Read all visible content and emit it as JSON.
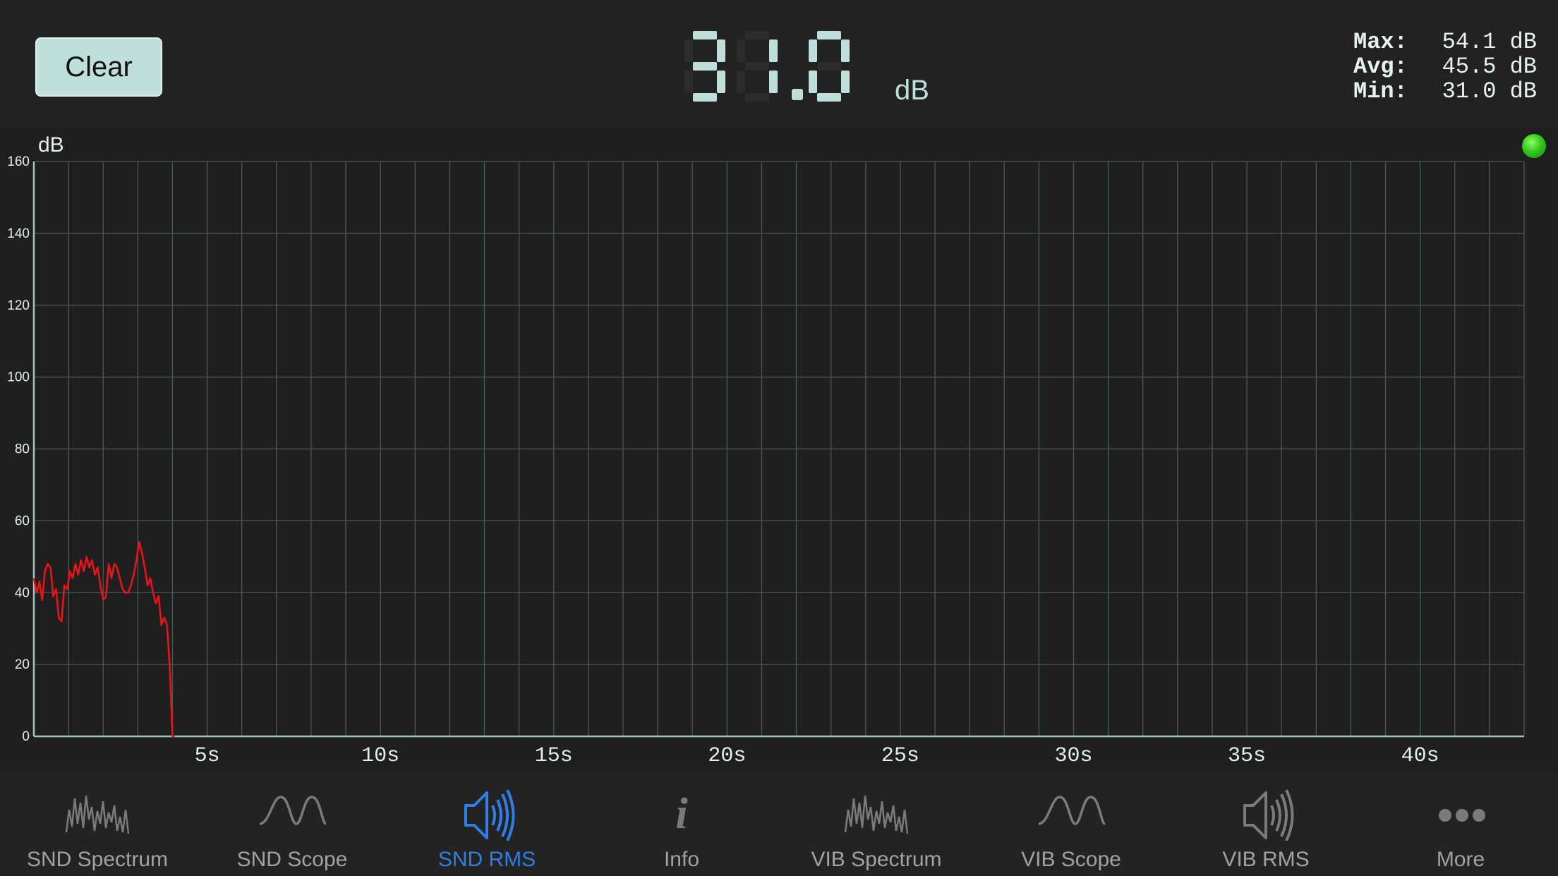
{
  "header": {
    "clear_label": "Clear",
    "reading_value": "31.0",
    "reading_unit": "dB",
    "stats": {
      "max_label": "Max:",
      "max_value": "54.1 dB",
      "avg_label": "Avg:",
      "avg_value": "45.5 dB",
      "min_label": "Min:",
      "min_value": "31.0 dB"
    }
  },
  "chart_data": {
    "type": "line",
    "ylabel": "dB",
    "xlabel": "",
    "ylim": [
      0,
      160
    ],
    "y_ticks": [
      "0",
      "20",
      "40",
      "60",
      "80",
      "100",
      "120",
      "140",
      "160"
    ],
    "x_ticks": [
      "5s",
      "10s",
      "15s",
      "20s",
      "25s",
      "30s",
      "35s",
      "40s"
    ],
    "x_tick_values": [
      5,
      10,
      15,
      20,
      25,
      30,
      35,
      40
    ],
    "xlim": [
      0,
      43
    ],
    "grid": true,
    "series": [
      {
        "color": "#e8141a",
        "x": [
          0.0,
          0.08,
          0.16,
          0.24,
          0.32,
          0.4,
          0.48,
          0.56,
          0.64,
          0.72,
          0.8,
          0.88,
          0.96,
          1.04,
          1.12,
          1.2,
          1.28,
          1.36,
          1.44,
          1.52,
          1.6,
          1.68,
          1.76,
          1.84,
          1.92,
          2.0,
          2.08,
          2.16,
          2.24,
          2.32,
          2.4,
          2.48,
          2.56,
          2.64,
          2.72,
          2.8,
          2.88,
          2.96,
          3.04,
          3.12,
          3.2,
          3.28,
          3.36,
          3.44,
          3.52,
          3.6,
          3.68,
          3.76,
          3.84,
          3.92,
          4.0,
          4.04,
          4.06
        ],
        "values": [
          44,
          40,
          43,
          38,
          46,
          48,
          47,
          39,
          41,
          33,
          32,
          42,
          41,
          46,
          44,
          48,
          45,
          49,
          46,
          50,
          47,
          49,
          45,
          47,
          42,
          38,
          39,
          48,
          44,
          48,
          47,
          44,
          41,
          40,
          40,
          42,
          45,
          49,
          54.1,
          51,
          47,
          42,
          44,
          40,
          37,
          39,
          31,
          33,
          31,
          20,
          0,
          0,
          0
        ]
      }
    ]
  },
  "status": {
    "indicator_color": "#34c81c"
  },
  "tabs": [
    {
      "label": "SND Spectrum",
      "icon": "spectrum-icon",
      "active": false
    },
    {
      "label": "SND Scope",
      "icon": "scope-wave-icon",
      "active": false
    },
    {
      "label": "SND RMS",
      "icon": "speaker-waves-icon",
      "active": true
    },
    {
      "label": "Info",
      "icon": "info-icon",
      "active": false
    },
    {
      "label": "VIB Spectrum",
      "icon": "spectrum-icon",
      "active": false
    },
    {
      "label": "VIB Scope",
      "icon": "scope-wave-icon",
      "active": false
    },
    {
      "label": "VIB RMS",
      "icon": "speaker-waves-icon",
      "active": false
    },
    {
      "label": "More",
      "icon": "more-dots-icon",
      "active": false
    }
  ],
  "colors": {
    "accent": "#2f7fe6",
    "lcd_on": "#bfe0da",
    "lcd_off": "#2c2c2c",
    "grid": "#4a5a56",
    "axis": "#9fc7bf",
    "trace": "#e8141a"
  }
}
